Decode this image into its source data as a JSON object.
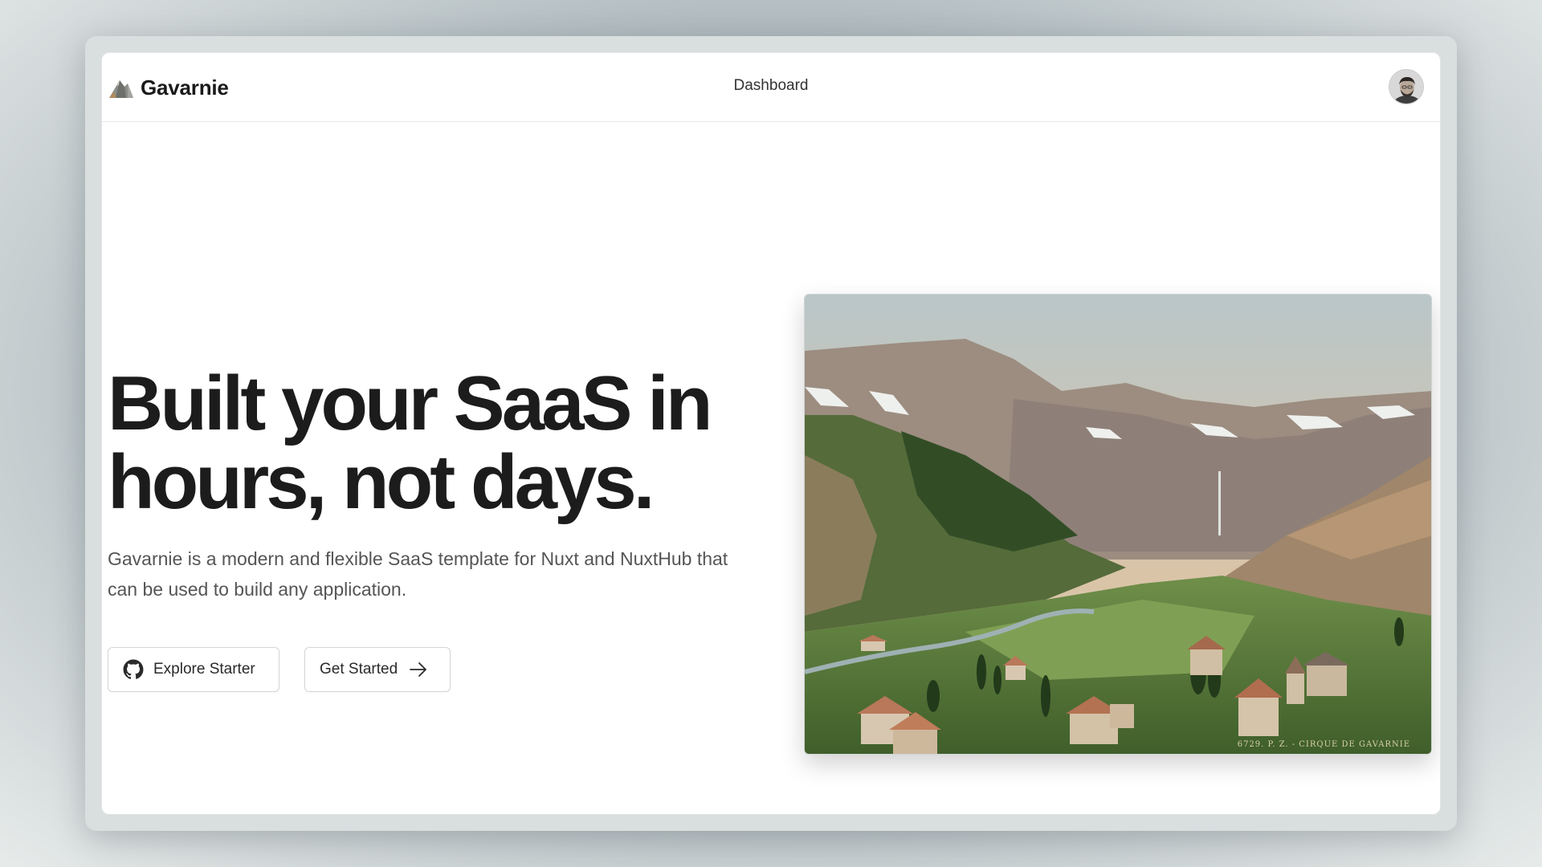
{
  "brand": {
    "name": "Gavarnie",
    "logo_icon": "mountain-icon"
  },
  "nav": {
    "links": [
      {
        "label": "Dashboard"
      }
    ]
  },
  "user": {
    "avatar_icon": "avatar"
  },
  "hero": {
    "title_line1": "Built your SaaS in",
    "title_line2": "hours, not days.",
    "description_line1": "Gavarnie is a modern and flexible SaaS template for Nuxt and NuxtHub that",
    "description_line2": "can be used to build any application.",
    "buttons": {
      "explore": {
        "label": "Explore Starter",
        "icon": "github-icon"
      },
      "started": {
        "label": "Get Started",
        "icon": "arrow-right-icon"
      }
    },
    "image": {
      "alt": "Cirque de Gavarnie landscape",
      "caption": "6729. P. Z. - CIRQUE DE GAVARNIE"
    }
  },
  "colors": {
    "text_primary": "#1c1c1c",
    "text_secondary": "#555555",
    "border": "#d3d6d8",
    "background": "#ffffff"
  }
}
